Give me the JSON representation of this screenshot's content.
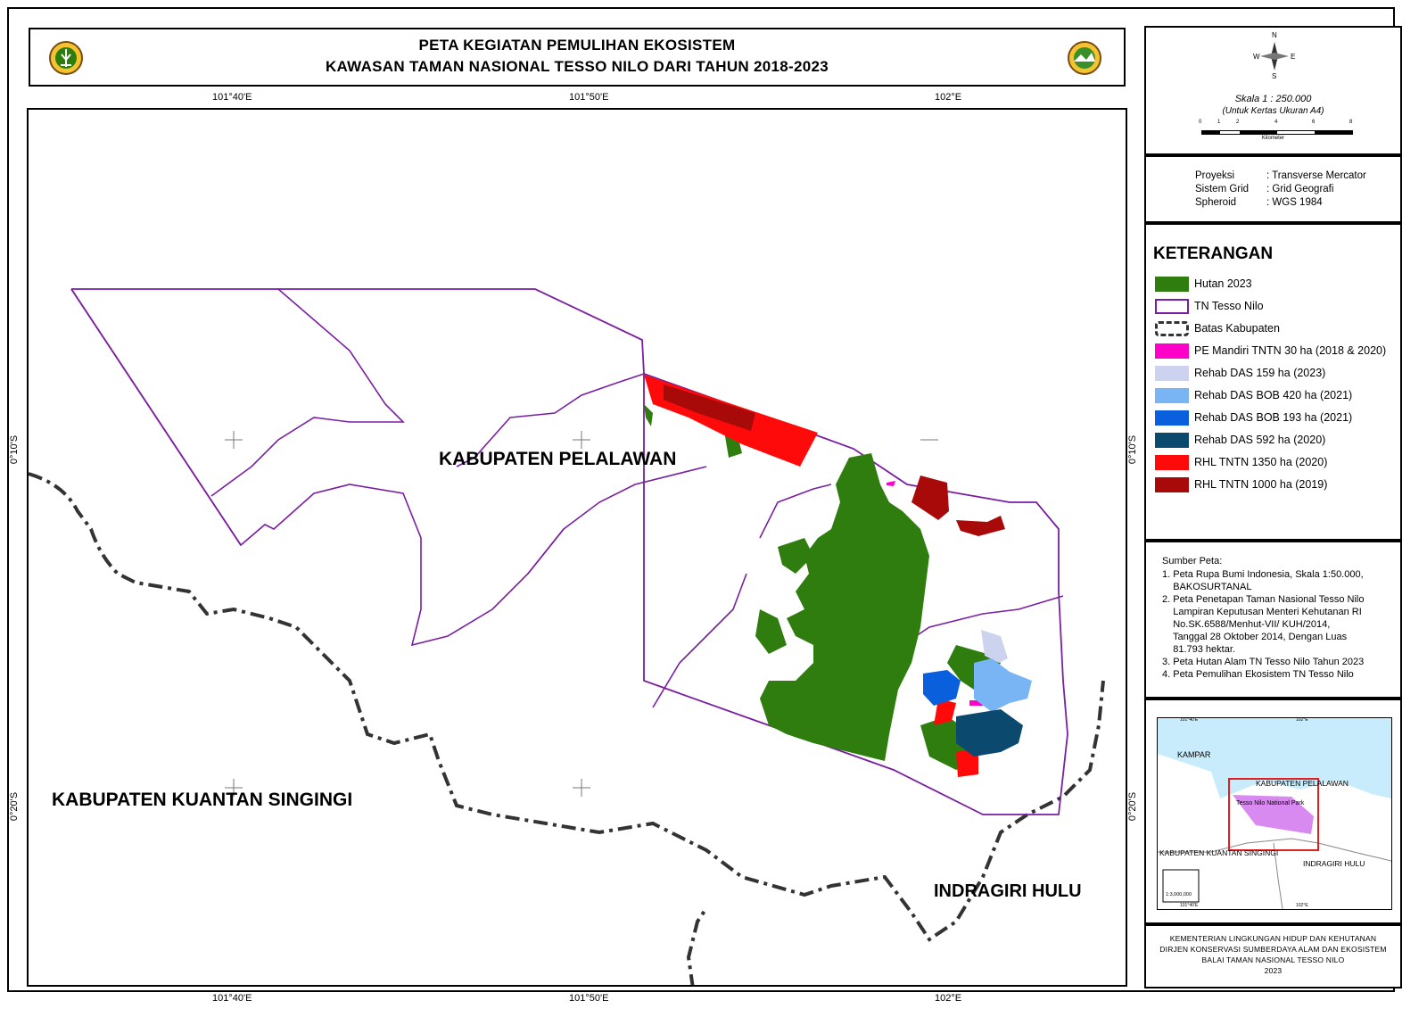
{
  "title": {
    "line1": "PETA KEGIATAN PEMULIHAN EKOSISTEM",
    "line2": "KAWASAN TAMAN NASIONAL TESSO NILO DARI TAHUN 2018-2023"
  },
  "grid": {
    "top_ticks": [
      "101°40'E",
      "101°50'E",
      "102°E"
    ],
    "bottom_ticks": [
      "101°40'E",
      "101°50'E",
      "102°E"
    ],
    "left_ticks": [
      "0°10'S",
      "0°20'S"
    ],
    "right_ticks": [
      "0°10'S",
      "0°20'S"
    ]
  },
  "map_labels": {
    "pelalawan": "KABUPATEN PELALAWAN",
    "kuantan": "KABUPATEN KUANTAN SINGINGI",
    "indragiri": "INDRAGIRI HULU"
  },
  "compass": {
    "n": "N",
    "s": "S",
    "e": "E",
    "w": "W"
  },
  "scale": {
    "text": "Skala 1 : 250.000",
    "sub": "(Untuk Kertas Ukuran A4)",
    "ticks": [
      "0",
      "1",
      "2",
      "4",
      "6",
      "8"
    ],
    "unit": "Kilometer"
  },
  "projection": [
    {
      "key": "Proyeksi",
      "value": ": Transverse Mercator"
    },
    {
      "key": "Sistem Grid",
      "value": ": Grid Geografi"
    },
    {
      "key": "Spheroid",
      "value": ": WGS 1984"
    }
  ],
  "legend": {
    "title": "KETERANGAN",
    "items": [
      {
        "label": "Hutan 2023",
        "color": "#2e7d0e"
      },
      {
        "label": "TN Tesso Nilo",
        "color": "#7a1fa2"
      },
      {
        "label": "Batas Kabupaten",
        "color": "#333333"
      },
      {
        "label": "PE Mandiri TNTN 30 ha (2018 & 2020)",
        "color": "#ff00c8"
      },
      {
        "label": "Rehab DAS 159 ha (2023)",
        "color": "#cdd3ee"
      },
      {
        "label": "Rehab DAS BOB 420 ha (2021)",
        "color": "#79b5f5"
      },
      {
        "label": "Rehab DAS BOB 193 ha (2021)",
        "color": "#0a5fdc"
      },
      {
        "label": "Rehab DAS 592 ha (2020)",
        "color": "#0b4a6e"
      },
      {
        "label": "RHL TNTN 1350 ha (2020)",
        "color": "#ff0a0a"
      },
      {
        "label": "RHL TNTN 1000 ha (2019)",
        "color": "#a80a0a"
      }
    ]
  },
  "sources": {
    "title": "Sumber Peta:",
    "lines": [
      "1. Peta Rupa Bumi Indonesia, Skala 1:50.000,",
      "    BAKOSURTANAL",
      "2. Peta Penetapan Taman Nasional Tesso Nilo",
      "    Lampiran Keputusan Menteri Kehutanan RI",
      "    No.SK.6588/Menhut-VII/ KUH/2014,",
      "    Tanggal 28 Oktober 2014, Dengan Luas",
      "    81.793 hektar.",
      "3. Peta Hutan Alam TN Tesso Nilo Tahun 2023",
      "4. Peta Pemulihan Ekosistem TN Tesso Nilo"
    ]
  },
  "inset": {
    "kampar": "KAMPAR",
    "pelalawan": "KABUPATEN PELALAWAN",
    "park": "Tesso Nilo National Park",
    "kuantan": "KABUPATEN KUANTAN SINGINGI",
    "indragiri": "INDRAGIRI HULU",
    "scale": "1:3,000,000",
    "tick_top_1": "101°40'E",
    "tick_top_2": "102°E",
    "tick_bottom_1": "101°40'E",
    "tick_bottom_2": "102°E"
  },
  "footer": {
    "line1": "KEMENTERIAN LINGKUNGAN HIDUP DAN KEHUTANAN",
    "line2": "DIRJEN KONSERVASI SUMBERDAYA ALAM DAN EKOSISTEM",
    "line3": "BALAI TAMAN NASIONAL TESSO NILO",
    "line4": "2023"
  }
}
